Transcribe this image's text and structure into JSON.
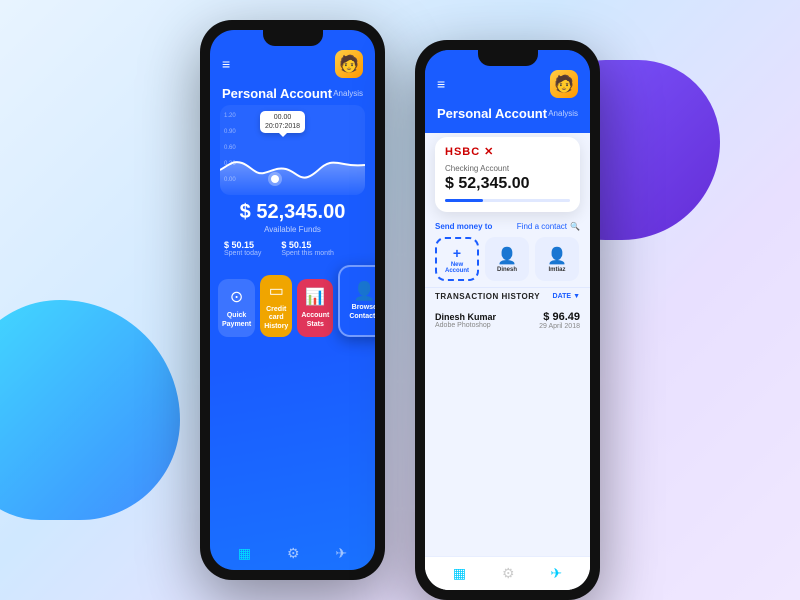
{
  "background": {
    "blob_tl": "cyan-blue gradient",
    "blob_tr": "purple gradient"
  },
  "phone1": {
    "header": {
      "title": "Personal Account",
      "analysis": "Analysis"
    },
    "chart": {
      "tooltip_value": "00.00",
      "tooltip_date": "20:07:2018",
      "y_labels": [
        "1.20",
        "0.90",
        "0.60",
        "0.30",
        "0.00"
      ]
    },
    "balance": {
      "amount": "$ 52,345.00",
      "label": "Available Funds"
    },
    "stats": [
      {
        "amount": "$ 50.15",
        "label": "Spent today"
      },
      {
        "amount": "$ 50.15",
        "label": "Spent this month"
      }
    ],
    "actions": [
      {
        "id": "quick-payment",
        "label": "Quick\nPayment",
        "icon": "⊙"
      },
      {
        "id": "credit-card",
        "label": "Credit card\nHistory",
        "icon": "💳"
      },
      {
        "id": "account-stats",
        "label": "Account\nStats",
        "icon": "📊"
      }
    ],
    "browse_contacts": {
      "label": "Browse\nContacts",
      "icon": "👤"
    },
    "nav": [
      "▦",
      "⚙",
      "✈"
    ]
  },
  "phone2": {
    "header": {
      "title": "Personal Account",
      "analysis": "Analysis"
    },
    "card": {
      "bank": "HSBC",
      "type": "Checking Account",
      "balance": "$ 52,345.00"
    },
    "send_money": {
      "label": "Send money to",
      "find": "Find a contact"
    },
    "contacts": [
      {
        "id": "new",
        "label": "New\nAccount"
      },
      {
        "id": "dinesh",
        "name": "Dinesh"
      },
      {
        "id": "imtiaz",
        "name": "Imtiaz"
      }
    ],
    "transaction_history": {
      "title": "TRANSACTION HISTORY",
      "date_label": "DATE"
    },
    "transactions": [
      {
        "name": "Dinesh Kumar",
        "sub": "Adobe Photoshop",
        "amount": "$ 96.49",
        "date": "29 April 2018"
      }
    ],
    "nav": [
      "▦",
      "⚙",
      "✈"
    ]
  }
}
